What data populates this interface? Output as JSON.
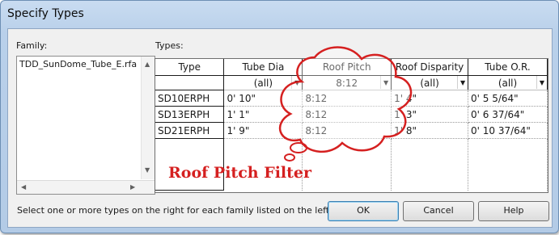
{
  "window": {
    "title": "Specify Types"
  },
  "family": {
    "label": "Family:",
    "items": [
      "TDD_SunDome_Tube_E.rfa"
    ]
  },
  "types": {
    "label": "Types:",
    "columns": [
      "Type",
      "Tube Dia",
      "Roof Pitch",
      "Roof Disparity",
      "Tube O.R."
    ],
    "filters": [
      "",
      "(all)",
      "8:12",
      "(all)",
      "(all)"
    ],
    "rows": [
      [
        "SD10ERPH",
        "0'  10\"",
        "8:12",
        "1'  4\"",
        "0'  5 5/64\""
      ],
      [
        "SD13ERPH",
        "1'  1\"",
        "8:12",
        "1'  3\"",
        "0'  6 37/64\""
      ],
      [
        "SD21ERPH",
        "1'  9\"",
        "8:12",
        "1'  8\"",
        "0'  10 37/64\""
      ]
    ]
  },
  "footer": {
    "hint": "Select one or more types on the right for each family listed on the left",
    "ok": "OK",
    "cancel": "Cancel",
    "help": "Help"
  },
  "annotation": {
    "text": "Roof Pitch Filter",
    "color": "#d52020"
  },
  "icons": {
    "dropdown": "chevron-down-icon",
    "scroll_up": "chevron-up-icon",
    "scroll_down": "chevron-down-icon",
    "scroll_left": "chevron-left-icon",
    "scroll_right": "chevron-right-icon"
  }
}
